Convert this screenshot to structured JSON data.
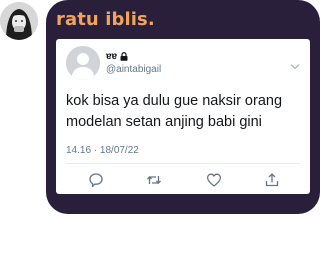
{
  "sender": {
    "name": "ratu iblis."
  },
  "tweet": {
    "display_name": "ɐɐ",
    "handle": "@aintabigail",
    "text": "kok bisa ya dulu gue naksir orang modelan setan anjing babi gini",
    "timestamp": "14.16 · 18/07/22",
    "icons": [
      "reply-icon",
      "retweet-icon",
      "like-icon",
      "share-icon"
    ]
  },
  "colors": {
    "bubble_bg": "#2a1f3a",
    "sender_name": "#f2a35c",
    "tweet_text": "#14171a",
    "muted_text": "#657786"
  }
}
